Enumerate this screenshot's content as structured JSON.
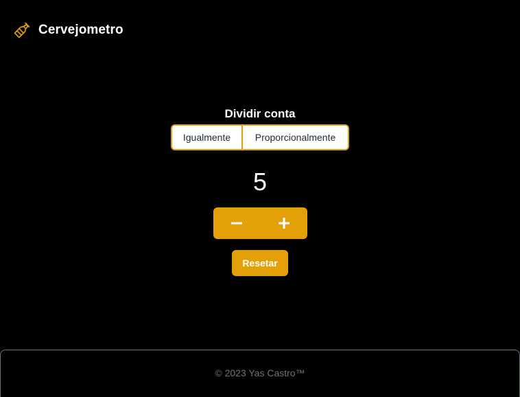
{
  "header": {
    "logo_icon": "beer-bottle-icon",
    "title": "Cervejometro"
  },
  "split": {
    "title": "Dividir conta",
    "options": [
      "Igualmente",
      "Proporcionalmente"
    ]
  },
  "counter": {
    "value": "5",
    "decrement_icon": "minus-icon",
    "increment_icon": "plus-icon"
  },
  "reset_label": "Resetar",
  "footer": {
    "copyright": "© 2023 Yas Castro™"
  },
  "colors": {
    "accent": "#e3a008",
    "background": "#000000",
    "text": "#ffffff",
    "muted": "#6b7280"
  }
}
